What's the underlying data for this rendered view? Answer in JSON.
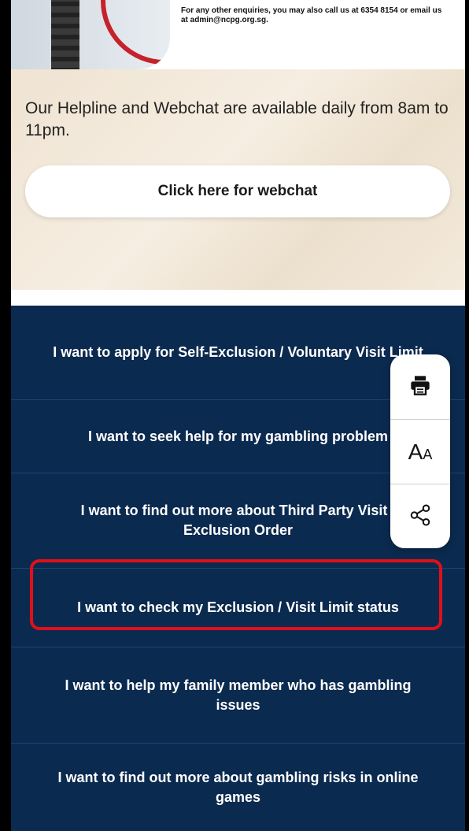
{
  "top": {
    "enquiry_text": "For any other enquiries, you may also call us at 6354 8154 or email us at admin@ncpg.org.sg."
  },
  "helpline": {
    "hours_text": "Our Helpline and Webchat are available daily from 8am to 11pm.",
    "webchat_button": "Click here for webchat"
  },
  "nav_items": [
    "I want to apply for Self-Exclusion / Voluntary Visit Limit",
    "I want to seek help for my gambling problem",
    "I want to find out more about Third Party Visit / Exclusion Order",
    "I want to check my Exclusion / Visit Limit status",
    "I want to help my family member who has gambling issues",
    "I want to find out more about gambling risks in online games"
  ],
  "toolbar": {
    "print_icon": "print-icon",
    "font_size_label": "Aa",
    "share_icon": "share-icon"
  },
  "colors": {
    "nav_bg": "#0b2a4f",
    "highlight": "#e0101a",
    "brand_red": "#c5222b"
  }
}
